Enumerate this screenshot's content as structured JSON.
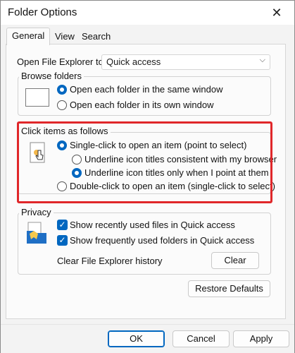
{
  "window": {
    "title": "Folder Options",
    "close_glyph": "✕"
  },
  "tabs": [
    {
      "label": "General",
      "active": true
    },
    {
      "label": "View",
      "active": false
    },
    {
      "label": "Search",
      "active": false
    }
  ],
  "open_explorer": {
    "label": "Open File Explorer to:",
    "value": "Quick access"
  },
  "browse_folders": {
    "title": "Browse folders",
    "options": [
      {
        "label": "Open each folder in the same window",
        "checked": true
      },
      {
        "label": "Open each folder in its own window",
        "checked": false
      }
    ]
  },
  "click_items": {
    "title": "Click items as follows",
    "single_click": "Single-click to open an item (point to select)",
    "underline_consistent": "Underline icon titles consistent with my browser",
    "underline_point": "Underline icon titles only when I point at them",
    "double_click": "Double-click to open an item (single-click to select)"
  },
  "privacy": {
    "title": "Privacy",
    "show_recent_files": "Show recently used files in Quick access",
    "show_frequent_folders": "Show frequently used folders in Quick access",
    "clear_history_label": "Clear File Explorer history",
    "clear_button": "Clear"
  },
  "buttons": {
    "restore_defaults": "Restore Defaults",
    "ok": "OK",
    "cancel": "Cancel",
    "apply": "Apply"
  },
  "colors": {
    "accent": "#0067c0",
    "highlight": "#e0272a"
  }
}
